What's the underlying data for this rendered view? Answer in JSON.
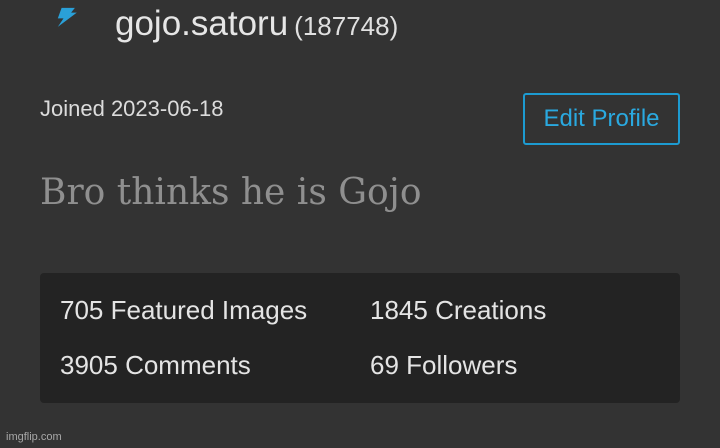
{
  "profile": {
    "icon": "lightning-bolt-icon",
    "username": "gojo.satoru",
    "user_id": "(187748)",
    "joined": "Joined 2023-06-18",
    "edit_label": "Edit Profile",
    "bio": "Bro thinks he is Gojo"
  },
  "stats": [
    {
      "label": "705 Featured Images"
    },
    {
      "label": "1845 Creations"
    },
    {
      "label": "3905 Comments"
    },
    {
      "label": "69 Followers"
    }
  ],
  "watermark": "imgflip.com",
  "colors": {
    "background": "#333333",
    "panel": "#232323",
    "accent": "#2aa9e0",
    "bio_text": "#8f8f8f"
  }
}
